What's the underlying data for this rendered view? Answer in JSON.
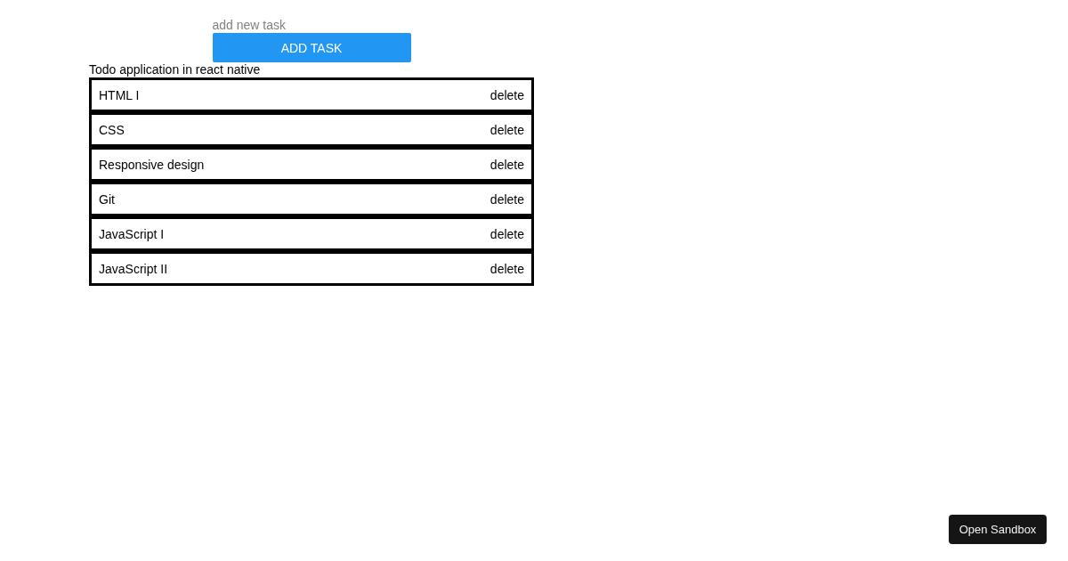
{
  "new_task_field": {
    "placeholder": "add new task"
  },
  "add_button": {
    "label": "ADD TASK"
  },
  "title": "Todo application in react native",
  "tasks": [
    {
      "text": "HTML I",
      "action": "delete"
    },
    {
      "text": "CSS",
      "action": "delete"
    },
    {
      "text": "Responsive design",
      "action": "delete"
    },
    {
      "text": "Git",
      "action": "delete"
    },
    {
      "text": "JavaScript I",
      "action": "delete"
    },
    {
      "text": "JavaScript II",
      "action": "delete"
    }
  ],
  "sandbox_button": {
    "label": "Open Sandbox"
  }
}
